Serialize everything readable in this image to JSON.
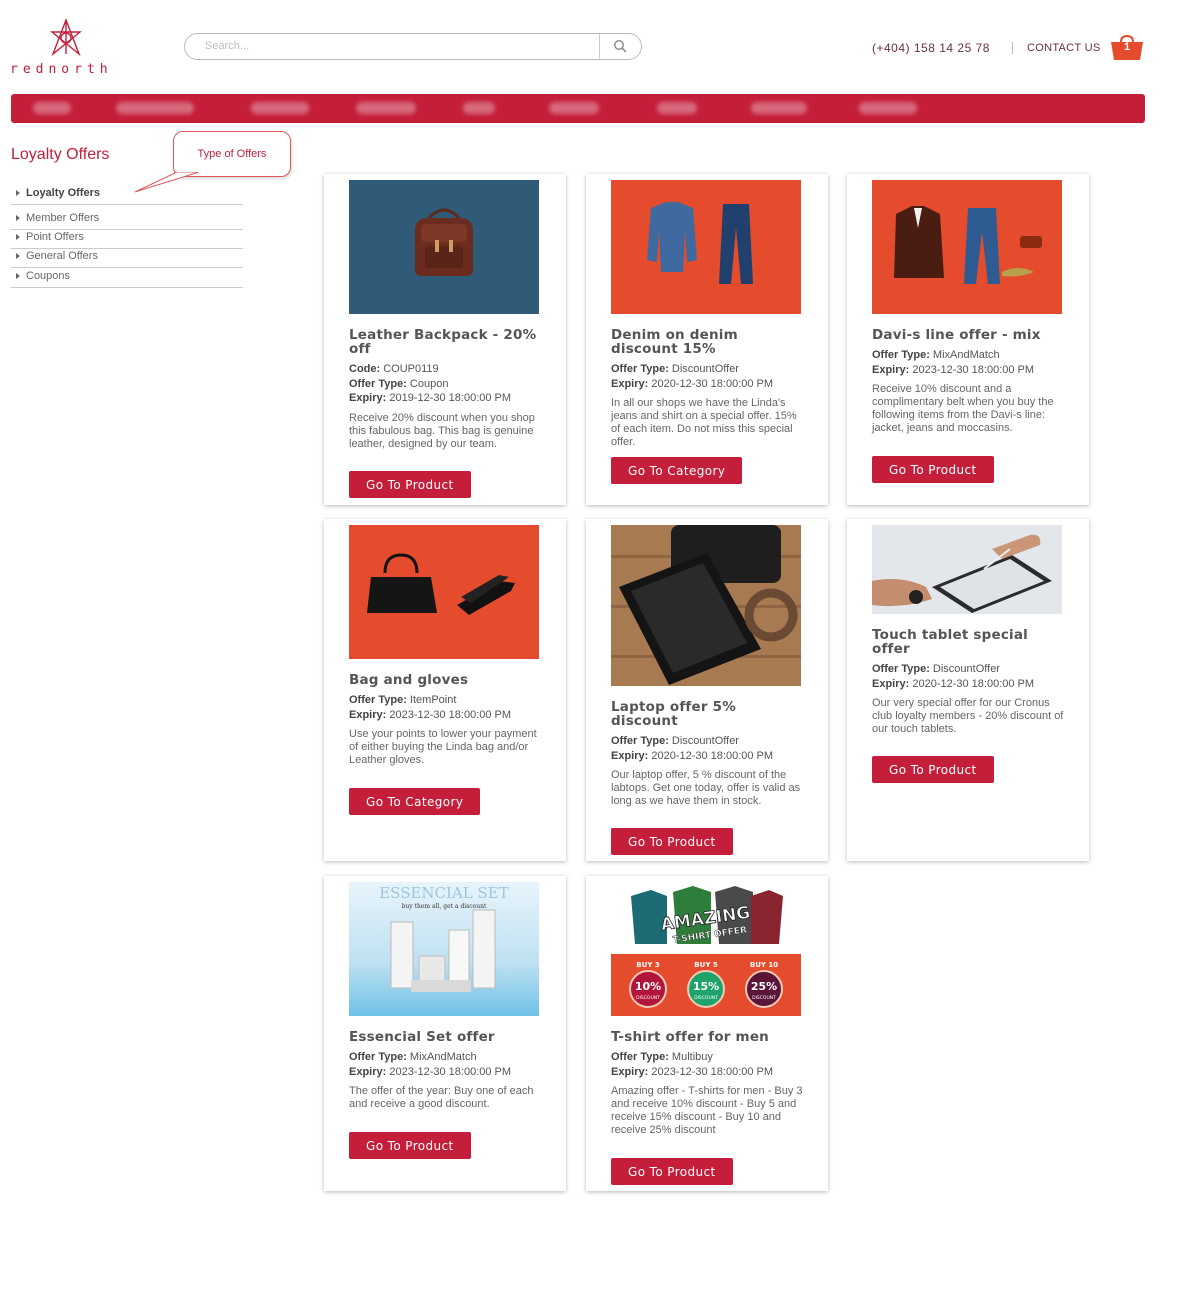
{
  "brand": {
    "logo_text": "rednorth"
  },
  "header": {
    "search_placeholder": "Search...",
    "phone": "(+404) 158 14 25 78",
    "contact": "CONTACT US",
    "cart_count": "1"
  },
  "sidebar": {
    "title": "Loyalty Offers",
    "items": [
      {
        "label": "Loyalty Offers"
      },
      {
        "label": "Member Offers"
      },
      {
        "label": "Point Offers"
      },
      {
        "label": "General Offers"
      },
      {
        "label": "Coupons"
      }
    ]
  },
  "callout": {
    "text": "Type of Offers"
  },
  "offers": [
    {
      "title": "Leather Backpack - 20% off",
      "code": "COUP0119",
      "type": "Coupon",
      "expiry": "2019-12-30 18:00:00 PM",
      "desc": "Receive 20% discount when you shop this fabulous bag. This bag is genuine leather, designed by our team.",
      "button": "Go To Product",
      "labels": {
        "code": "Code:",
        "type": "Offer Type:",
        "expiry": "Expiry:"
      }
    },
    {
      "title": "Denim on denim discount 15%",
      "type": "DiscountOffer",
      "expiry": "2020-12-30 18:00:00 PM",
      "desc": "In all our shops we have the Linda's jeans and shirt on a special offer. 15% of each item. Do not miss this special offer.",
      "button": "Go To Category",
      "labels": {
        "type": "Offer Type:",
        "expiry": "Expiry:"
      }
    },
    {
      "title": "Davi-s line offer - mix",
      "type": "MixAndMatch",
      "expiry": "2023-12-30 18:00:00 PM",
      "desc": "Receive 10% discount and a complimentary belt when you buy the following items from the Davi-s line: jacket, jeans and moccasins.",
      "button": "Go To Product",
      "labels": {
        "type": "Offer Type:",
        "expiry": "Expiry:"
      }
    },
    {
      "title": "Bag and gloves",
      "type": "ItemPoint",
      "expiry": "2023-12-30 18:00:00 PM",
      "desc": "Use your points to lower your payment of either buying the Linda bag and/or Leather gloves.",
      "button": "Go To Category",
      "labels": {
        "type": "Offer Type:",
        "expiry": "Expiry:"
      }
    },
    {
      "title": "Laptop offer 5% discount",
      "type": "DiscountOffer",
      "expiry": "2020-12-30 18:00:00 PM",
      "desc": "Our laptop offer, 5 % discount of the labtops. Get one today, offer is valid as long as we have them in stock.",
      "button": "Go To Product",
      "labels": {
        "type": "Offer Type:",
        "expiry": "Expiry:"
      }
    },
    {
      "title": "Touch tablet special offer",
      "type": "DiscountOffer",
      "expiry": "2020-12-30 18:00:00 PM",
      "desc": "Our very special offer for our Cronus club loyalty members - 20% discount of our touch tablets.",
      "button": "Go To Product",
      "labels": {
        "type": "Offer Type:",
        "expiry": "Expiry:"
      }
    },
    {
      "title": "Essencial Set offer",
      "type": "MixAndMatch",
      "expiry": "2023-12-30 18:00:00 PM",
      "desc": "The offer of the year: Buy one of each and receive a good discount.",
      "button": "Go To Product",
      "labels": {
        "type": "Offer Type:",
        "expiry": "Expiry:"
      }
    },
    {
      "title": "T-shirt offer for men",
      "type": "Multibuy",
      "expiry": "2023-12-30 18:00:00 PM",
      "desc": "Amazing offer - T-shirts for men - Buy 3 and receive 10% discount - Buy 5 and receive 15% discount - Buy 10 and receive 25% discount",
      "button": "Go To Product",
      "labels": {
        "type": "Offer Type:",
        "expiry": "Expiry:"
      }
    }
  ],
  "images": {
    "essencial_title": "ESSENCIAL SET",
    "essencial_sub": "buy them all, get a discount",
    "tshirt_title_1": "AMAZING",
    "tshirt_title_2": "T-SHIRT OFFER",
    "tshirt_tiers": [
      {
        "label": "BUY 3",
        "pct": "10%",
        "sub": "DISCOUNT",
        "color": "#b3143c"
      },
      {
        "label": "BUY 5",
        "pct": "15%",
        "sub": "DISCOUNT",
        "color": "#1ea36a"
      },
      {
        "label": "BUY 10",
        "pct": "25%",
        "sub": "DISCOUNT",
        "color": "#5a1538"
      }
    ]
  },
  "colors": {
    "accent": "#c41e3a",
    "card_orange": "#e54b2d",
    "card_teal": "#2f5b78"
  }
}
